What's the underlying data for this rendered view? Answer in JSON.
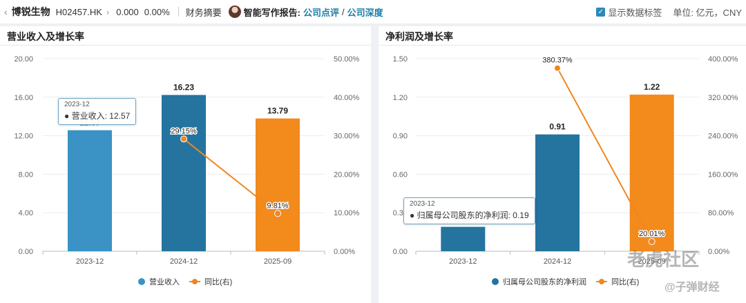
{
  "topbar": {
    "back_icon": "chevron-left-icon",
    "company": "博锐生物",
    "code": "H02457.HK",
    "forward_icon": "chevron-right-icon",
    "price": "0.000",
    "change_pct": "0.00%",
    "finance_summary": "财务摘要",
    "ai_label": "智能写作报告:",
    "link_comment": "公司点评",
    "slash": "/",
    "link_depth": "公司深度",
    "show_labels": "显示数据标签",
    "unit": "单位: 亿元，CNY"
  },
  "colors": {
    "bar_blue": "#3a93c4",
    "bar_dark_blue": "#24749f",
    "bar_orange": "#f28a1c",
    "line_orange": "#f0861f",
    "link": "#1a7fa8"
  },
  "chart_data": [
    {
      "type": "bar",
      "title": "营业收入及增长率",
      "categories": [
        "2023-12",
        "2024-12",
        "2025-09"
      ],
      "left_ticks": [
        "20.00",
        "16.00",
        "12.00",
        "8.00",
        "4.00",
        "0.00"
      ],
      "right_ticks": [
        "50.00%",
        "40.00%",
        "30.00%",
        "20.00%",
        "10.00%",
        "0.00%"
      ],
      "ylim": [
        0,
        20
      ],
      "y2lim": [
        0,
        50
      ],
      "series": [
        {
          "name": "营业收入",
          "values": [
            12.57,
            16.23,
            13.79
          ],
          "labels": [
            "12.57",
            "16.23",
            "13.79"
          ]
        },
        {
          "name": "同比(右)",
          "values": [
            null,
            29.15,
            9.81
          ],
          "labels": [
            "",
            "29.15%",
            "9.81%"
          ]
        }
      ],
      "tooltip": {
        "date": "2023-12",
        "label": "营业收入:",
        "value": "12.57"
      },
      "legend_position": "bottom"
    },
    {
      "type": "bar",
      "title": "净利润及增长率",
      "categories": [
        "2023-12",
        "2024-12",
        "2025-09"
      ],
      "left_ticks": [
        "1.50",
        "1.20",
        "0.90",
        "0.60",
        "0.30",
        "0.00"
      ],
      "right_ticks": [
        "400.00%",
        "320.00%",
        "240.00%",
        "160.00%",
        "80.00%",
        "0.00%"
      ],
      "ylim": [
        0,
        1.5
      ],
      "y2lim": [
        0,
        400
      ],
      "series": [
        {
          "name": "归属母公司股东的净利润",
          "values": [
            0.19,
            0.91,
            1.22
          ],
          "labels": [
            "0.19",
            "0.91",
            "1.22"
          ]
        },
        {
          "name": "同比(右)",
          "values": [
            null,
            380.37,
            20.01
          ],
          "labels": [
            "",
            "380.37%",
            "20.01%"
          ]
        }
      ],
      "tooltip": {
        "date": "2023-12",
        "label": "归属母公司股东的净利润:",
        "value": "0.19"
      },
      "legend_position": "bottom"
    }
  ],
  "watermarks": {
    "tiger": "老虎社区",
    "zidan": "@子弹财经"
  }
}
